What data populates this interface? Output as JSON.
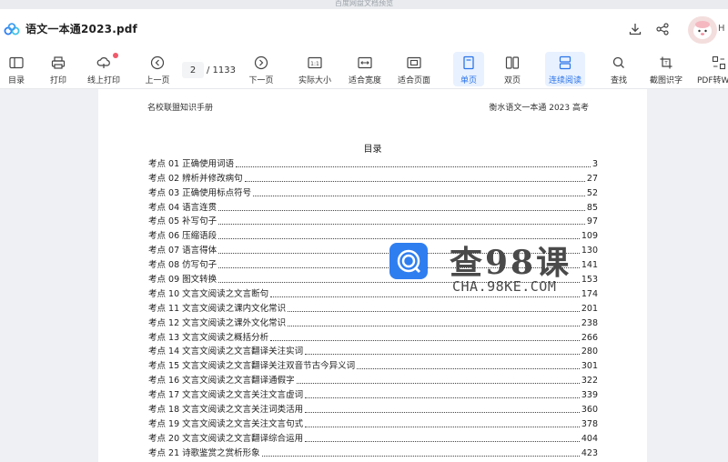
{
  "window": {
    "title": "百度网盘文档预览"
  },
  "header": {
    "filename": "语文一本通2023.pdf",
    "avatar_text": "H"
  },
  "toolbar": {
    "catalog": "目录",
    "print": "打印",
    "online_print": "线上打印",
    "prev_page": "上一页",
    "page_current": "2",
    "page_total": "/ 1133",
    "next_page": "下一页",
    "actual_size": "实际大小",
    "fit_width": "适合宽度",
    "fit_page": "适合页面",
    "single_page": "单页",
    "double_page": "双页",
    "continuous": "连续阅读",
    "search": "查找",
    "screenshot_ocr": "截图识字",
    "pdf_convert": "PDF转W"
  },
  "document": {
    "header_left": "名校联盟知识手册",
    "header_right": "衡水语文一本通 2023 高考",
    "toc_title": "目录",
    "toc": [
      {
        "title": "考点 01  正确使用词语",
        "page": "3"
      },
      {
        "title": "考点 02  辨析并修改病句",
        "page": "27"
      },
      {
        "title": "考点 03  正确使用标点符号",
        "page": "52"
      },
      {
        "title": "考点 04  语言连贯",
        "page": "85"
      },
      {
        "title": "考点 05  补写句子",
        "page": "97"
      },
      {
        "title": "考点 06  压缩语段",
        "page": "109"
      },
      {
        "title": "考点 07  语言得体",
        "page": "130"
      },
      {
        "title": "考点 08  仿写句子",
        "page": "141"
      },
      {
        "title": "考点 09  图文转换",
        "page": "153"
      },
      {
        "title": "考点 10  文言文阅读之文言断句",
        "page": "174"
      },
      {
        "title": "考点 11  文言文阅读之课内文化常识",
        "page": "201"
      },
      {
        "title": "考点 12  文言文阅读之课外文化常识",
        "page": "238"
      },
      {
        "title": "考点 13  文言文阅读之概括分析",
        "page": "266"
      },
      {
        "title": "考点 14  文言文阅读之文言翻译关注实词",
        "page": "280"
      },
      {
        "title": "考点 15  文言文阅读之文言翻译关注双音节古今异义词",
        "page": "301"
      },
      {
        "title": "考点 16  文言文阅读之文言翻译通假字",
        "page": "322"
      },
      {
        "title": "考点 17  文言文阅读之文言关注文言虚词",
        "page": "339"
      },
      {
        "title": "考点 18  文言文阅读之文言关注词类活用",
        "page": "360"
      },
      {
        "title": "考点 19  文言文阅读之文言关注文言句式",
        "page": "378"
      },
      {
        "title": "考点 20  文言文阅读之文言翻译综合运用",
        "page": "404"
      },
      {
        "title": "考点 21  诗歌鉴赏之赏析形象",
        "page": "423"
      }
    ]
  },
  "watermark": {
    "big": "查98课",
    "small": "CHA.98KE.COM"
  },
  "colors": {
    "accent": "#2b74e8",
    "active_bg": "#e8f1ff",
    "notification": "#f05a6a",
    "watermark_icon": "#2f7ef0"
  }
}
